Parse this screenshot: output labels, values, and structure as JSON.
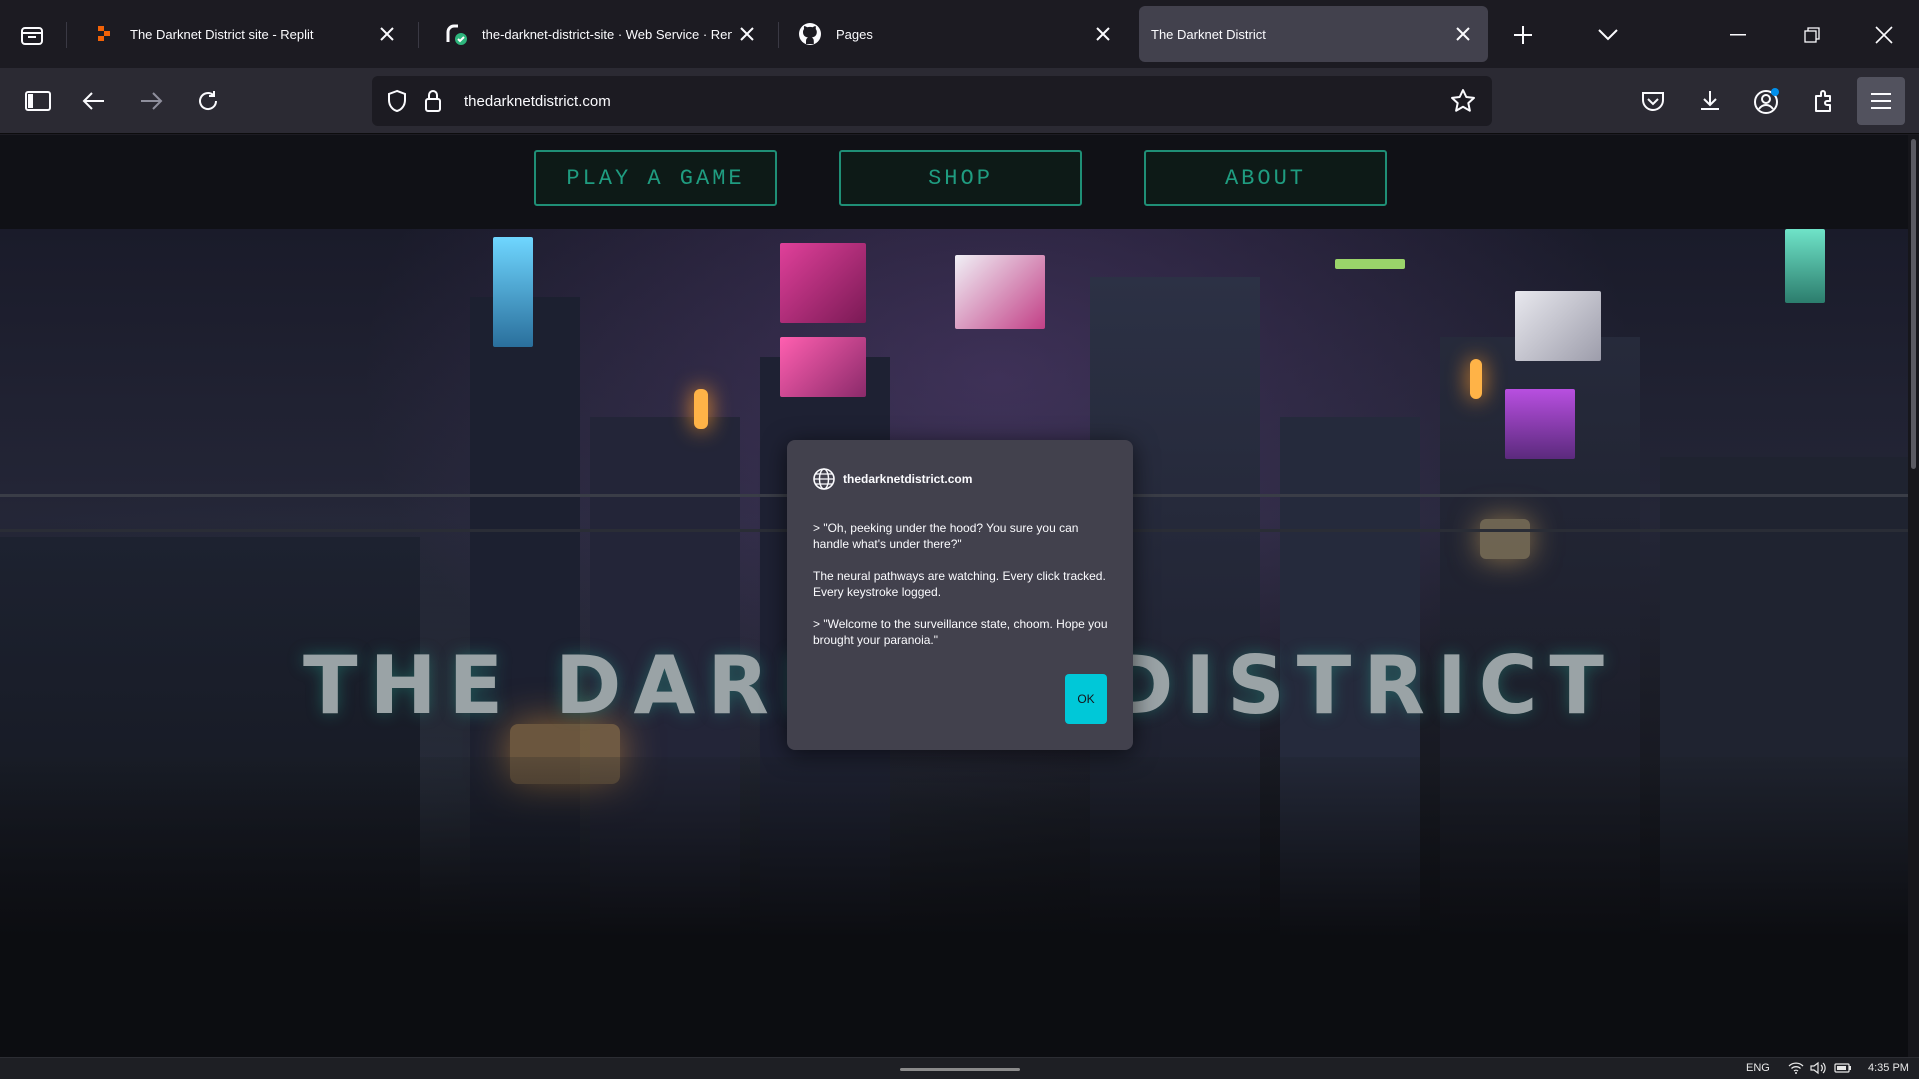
{
  "browser": {
    "tabs": [
      {
        "title": "The Darknet District site - Replit",
        "favicon": "replit-icon",
        "active": false
      },
      {
        "title": "the-darknet-district-site · Web Service · Render",
        "favicon": "render-icon",
        "active": false
      },
      {
        "title": "Pages",
        "favicon": "github-icon",
        "active": false
      },
      {
        "title": "The Darknet District",
        "favicon": "",
        "active": true
      }
    ],
    "url": "thedarknetdistrict.com"
  },
  "site": {
    "nav": [
      "PLAY A GAME",
      "SHOP",
      "ABOUT"
    ],
    "hero_title": "THE DARKNET DISTRICT"
  },
  "dialog": {
    "origin": "thedarknetdistrict.com",
    "paragraphs": [
      "> \"Oh, peeking under the hood? You sure you can handle what's under there?\"",
      "The neural pathways are watching. Every click tracked. Every keystroke logged.",
      "> \"Welcome to the surveillance state, choom. Hope you brought your paranoia.\""
    ],
    "ok_label": "OK"
  },
  "taskbar": {
    "language": "ENG",
    "time": "4:35 PM"
  },
  "colors": {
    "accent_teal": "#1f9c80",
    "ok_button": "#00c8d8"
  }
}
